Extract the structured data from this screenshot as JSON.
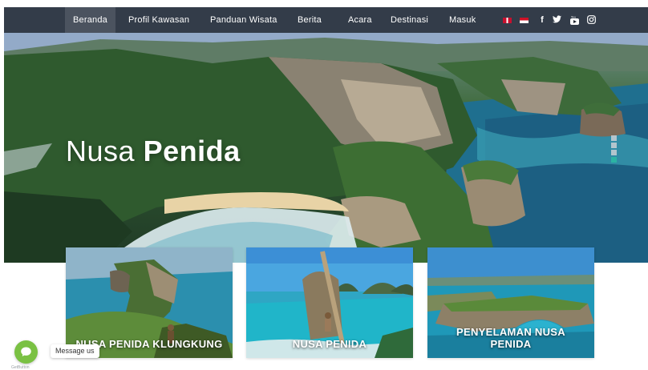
{
  "nav": {
    "items": [
      {
        "label": "Beranda",
        "active": true
      },
      {
        "label": "Profil Kawasan",
        "active": false
      },
      {
        "label": "Panduan Wisata",
        "active": false
      },
      {
        "label": "Berita",
        "active": false
      },
      {
        "label": "Acara",
        "active": false
      },
      {
        "label": "Destinasi",
        "active": false
      },
      {
        "label": "Masuk",
        "active": false
      }
    ],
    "languages": [
      {
        "code": "en",
        "icon": "uk-flag-icon"
      },
      {
        "code": "id",
        "icon": "indonesia-flag-icon"
      }
    ],
    "social": [
      {
        "name": "facebook",
        "glyph": "f",
        "icon": "facebook-icon"
      },
      {
        "name": "twitter",
        "glyph": "🐦",
        "icon": "twitter-icon"
      },
      {
        "name": "youtube",
        "glyph": "▶",
        "icon": "youtube-icon"
      },
      {
        "name": "instagram",
        "glyph": "◎",
        "icon": "instagram-icon"
      }
    ]
  },
  "hero": {
    "title_light": "Nusa",
    "title_bold": "Penida",
    "slider_count": 4,
    "slider_active": 3
  },
  "cards": [
    {
      "title": "NUSA PENIDA KLUNGKUNG"
    },
    {
      "title": "NUSA PENIDA"
    },
    {
      "title": "PENYELAMAN NUSA PENIDA"
    }
  ],
  "chat": {
    "label": "Message us",
    "brand": "GetButton"
  },
  "colors": {
    "accent": "#2bb3a3",
    "chat_green": "#7ac143",
    "nav_bg": "#1e232d"
  }
}
